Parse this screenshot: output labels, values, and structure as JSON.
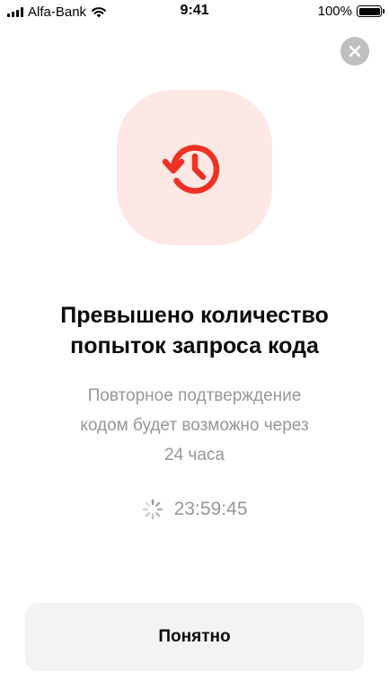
{
  "status_bar": {
    "carrier": "Alfa-Bank",
    "time": "9:41",
    "battery": "100%",
    "icons": [
      "signal-icon",
      "wifi-icon",
      "battery-icon"
    ]
  },
  "dialog": {
    "close_icon": "close-icon",
    "hero_icon": "history-clock-icon",
    "title_line1": "Превышено количество",
    "title_line2": "попыток запроса кода",
    "subtitle_line1": "Повторное подтверждение",
    "subtitle_line2": "кодом будет возможно через",
    "subtitle_line3": "24 часа",
    "timer": {
      "icon": "spinner-icon",
      "value": "23:59:45"
    },
    "button_label": "Понятно"
  },
  "colors": {
    "accent": "#ef3124",
    "tile_bg": "#fde8e6",
    "muted_text": "#97979c",
    "button_bg": "#f2f3f5"
  }
}
